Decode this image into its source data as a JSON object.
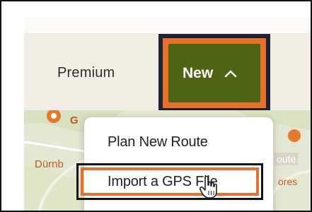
{
  "nav": {
    "premium_label": "Premium",
    "new_button_label": "New",
    "new_button_icon": "chevron-up-icon"
  },
  "dropdown": {
    "items": [
      {
        "label": "Plan New Route"
      },
      {
        "label": "Import a GPS File"
      }
    ]
  },
  "map": {
    "labels": [
      "G",
      "Dürnb",
      "oute",
      "ores"
    ]
  },
  "colors": {
    "brand_green": "#4f6412",
    "highlight_orange": "#e8702a",
    "highlight_navy": "#1e2232",
    "navbar_bg": "#f3eee3",
    "map_green": "#e6ead6"
  }
}
